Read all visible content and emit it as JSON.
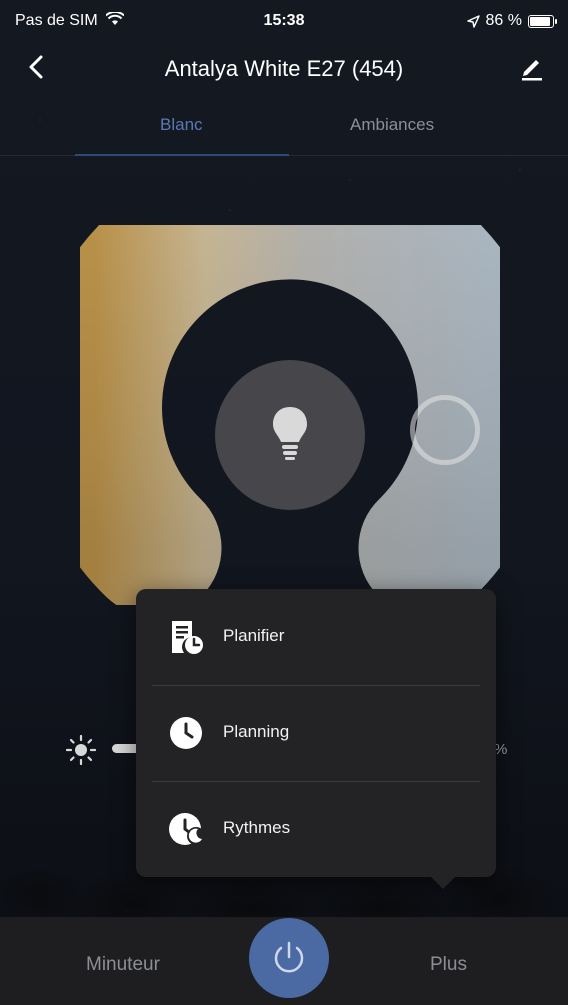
{
  "status_bar": {
    "carrier": "Pas de SIM",
    "time": "15:38",
    "battery": "86 %"
  },
  "nav": {
    "title": "Antalya White E27 (454)"
  },
  "tabs": [
    {
      "label": "Blanc",
      "active": true
    },
    {
      "label": "Ambiances",
      "active": false
    }
  ],
  "brightness": {
    "percent_fragment": "%"
  },
  "menu": {
    "items": [
      {
        "label": "Planifier",
        "icon": "schedule-calendar-icon"
      },
      {
        "label": "Planning",
        "icon": "clock-icon"
      },
      {
        "label": "Rythmes",
        "icon": "moon-clock-icon"
      }
    ]
  },
  "bottom_bar": {
    "left_label": "Minuteur",
    "right_label": "Plus"
  },
  "colors": {
    "accent": "#4b69a3",
    "tab_active": "#5a79b3",
    "warm": "#c4a15a",
    "cool": "#c8ccd2"
  }
}
